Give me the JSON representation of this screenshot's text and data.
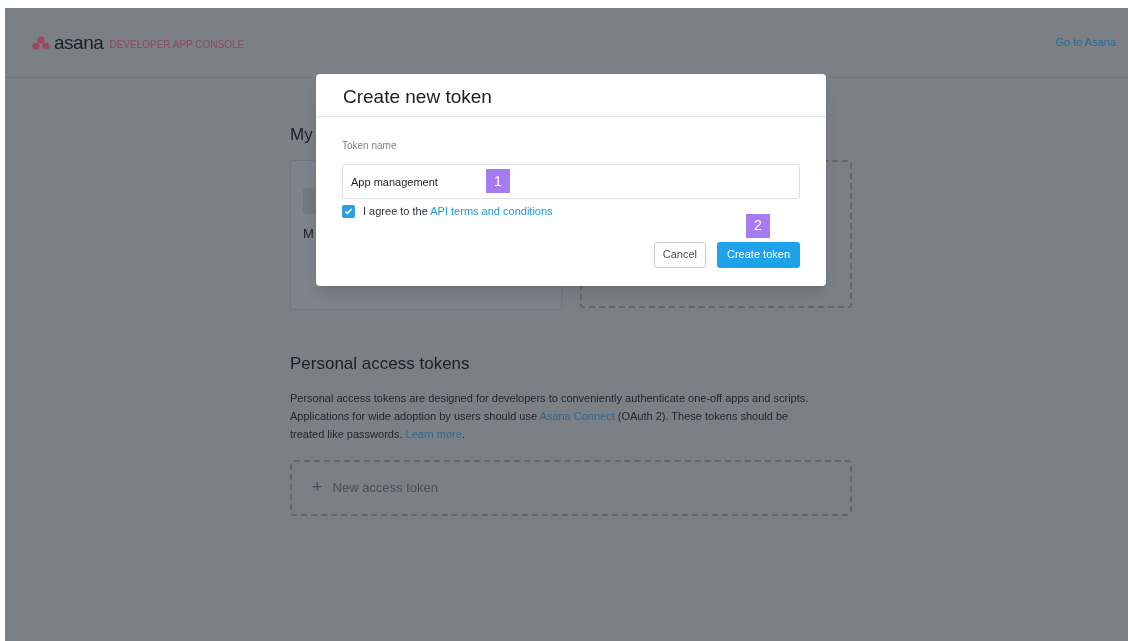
{
  "header": {
    "logo": "asana",
    "subtitle": "DEVELOPER APP CONSOLE",
    "link": "Go to Asana"
  },
  "apps": {
    "heading": "My",
    "card_text": "M"
  },
  "tokens": {
    "heading": "Personal access tokens",
    "description": [
      {
        "kind": "text",
        "text": "Personal access tokens are designed for developers to conveniently authenticate one-off apps and scripts. Applications for wide adoption by users should use "
      },
      {
        "kind": "link",
        "text": "Asana Connect"
      },
      {
        "kind": "text",
        "text": " (OAuth 2). These tokens should be treated like passwords. "
      },
      {
        "kind": "link",
        "text": "Learn more"
      },
      {
        "kind": "text",
        "text": "."
      }
    ],
    "new_button": {
      "icon": "+",
      "label": "New access token"
    }
  },
  "modal": {
    "title": "Create new token",
    "field_label": "Token name",
    "field_value": "App management",
    "field_step": "1",
    "agree": {
      "checked": true,
      "text": "I agree to the ",
      "link": "API terms and conditions"
    },
    "buttons": [
      {
        "kind": "secondary",
        "label": "Cancel"
      },
      {
        "kind": "primary",
        "label": "Create token"
      }
    ],
    "button_step": "2"
  }
}
